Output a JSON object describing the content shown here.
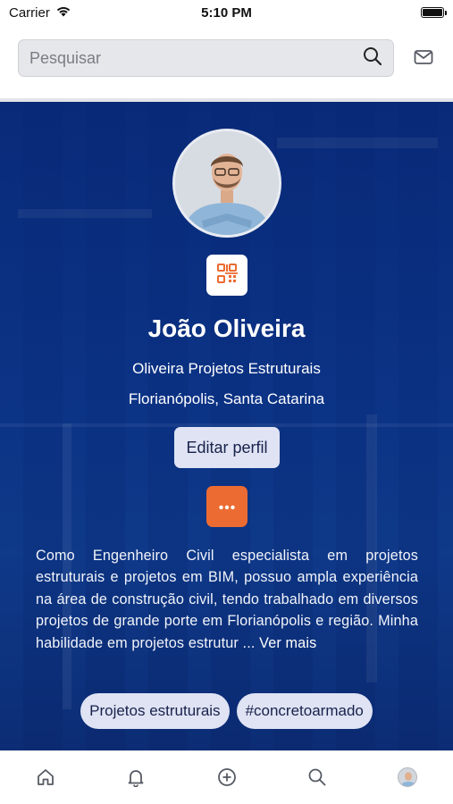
{
  "status_bar": {
    "carrier": "Carrier",
    "time": "5:10 PM"
  },
  "search": {
    "placeholder": "Pesquisar"
  },
  "profile": {
    "name": "João Oliveira",
    "company": "Oliveira Projetos Estruturais",
    "location": "Florianópolis, Santa Catarina",
    "edit_label": "Editar perfil",
    "more_label": "•••",
    "bio": "Como Engenheiro Civil especialista em projetos estruturais e projetos em BIM, possuo ampla experiência na área de construção civil, tendo trabalhado em diversos projetos de grande porte em Florianópolis e região. Minha habilidade em projetos estrutur ...",
    "see_more": "Ver mais",
    "tags": [
      "Projetos estruturais",
      "#concretoarmado"
    ]
  },
  "icons": {
    "wifi": "wifi-icon",
    "battery": "battery-icon",
    "search": "search-icon",
    "mail": "mail-icon",
    "qr": "qr-code-icon",
    "more": "more-icon",
    "nav": [
      "home-icon",
      "bell-icon",
      "plus-circle-icon",
      "search-icon",
      "avatar"
    ]
  },
  "colors": {
    "accent": "#ec6b32",
    "hero_blue": "#0d3484",
    "pill_bg": "#dfe3f4",
    "pill_text": "#18224a",
    "icon_gray": "#555a63"
  }
}
